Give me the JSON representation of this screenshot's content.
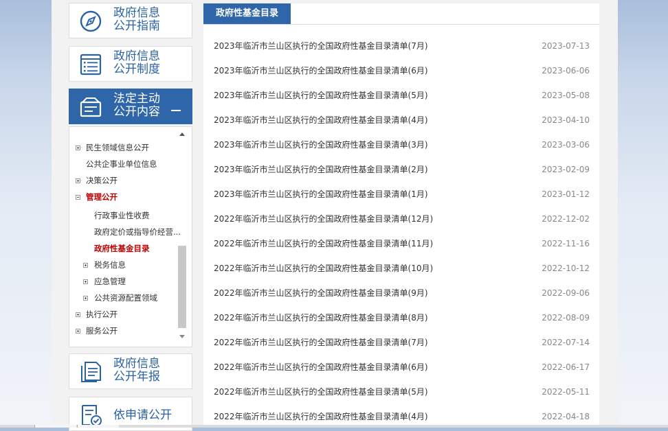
{
  "nav_cards": [
    {
      "line1": "政府信息",
      "line2": "公开指南",
      "icon": "compass-icon"
    },
    {
      "line1": "政府信息",
      "line2": "公开制度",
      "icon": "list-document-icon"
    },
    {
      "line1": "法定主动",
      "line2": "公开内容",
      "icon": "inbox-card-icon",
      "active": true
    },
    {
      "line1": "政府信息",
      "line2": "公开年报",
      "icon": "report-document-icon"
    },
    {
      "line1": "依申请公开",
      "icon": "application-check-icon"
    }
  ],
  "tree": {
    "items": [
      {
        "label": "民生领域信息公开",
        "expander": "plus"
      },
      {
        "label": "公共企事业单位信息"
      },
      {
        "label": "决策公开",
        "expander": "plus"
      },
      {
        "label": "管理公开",
        "expander": "minus",
        "current": true
      },
      {
        "label": "行政事业性收费"
      },
      {
        "label": "政府定价或指导价经营..."
      },
      {
        "label": "政府性基金目录",
        "current": true
      },
      {
        "label": "税务信息",
        "expander": "plus"
      },
      {
        "label": "应急管理",
        "expander": "plus"
      },
      {
        "label": "公共资源配置领域",
        "expander": "plus"
      },
      {
        "label": "执行公开",
        "expander": "plus"
      },
      {
        "label": "服务公开",
        "expander": "plus"
      }
    ]
  },
  "main": {
    "tab_title": "政府性基金目录",
    "list": [
      {
        "title": "2023年临沂市兰山区执行的全国政府性基金目录清单(7月)",
        "date": "2023-07-13"
      },
      {
        "title": "2023年临沂市兰山区执行的全国政府性基金目录清单(6月)",
        "date": "2023-06-06"
      },
      {
        "title": "2023年临沂市兰山区执行的全国政府性基金目录清单(5月)",
        "date": "2023-05-08"
      },
      {
        "title": "2023年临沂市兰山区执行的全国政府性基金目录清单(4月)",
        "date": "2023-04-10"
      },
      {
        "title": "2023年临沂市兰山区执行的全国政府性基金目录清单(3月)",
        "date": "2023-03-06"
      },
      {
        "title": "2023年临沂市兰山区执行的全国政府性基金目录清单(2月)",
        "date": "2023-02-09"
      },
      {
        "title": "2023年临沂市兰山区执行的全国政府性基金目录清单(1月)",
        "date": "2023-01-12"
      },
      {
        "title": "2022年临沂市兰山区执行的全国政府性基金目录清单(12月)",
        "date": "2022-12-02"
      },
      {
        "title": "2022年临沂市兰山区执行的全国政府性基金目录清单(11月)",
        "date": "2022-11-16"
      },
      {
        "title": "2022年临沂市兰山区执行的全国政府性基金目录清单(10月)",
        "date": "2022-10-12"
      },
      {
        "title": "2022年临沂市兰山区执行的全国政府性基金目录清单(9月)",
        "date": "2022-09-06"
      },
      {
        "title": "2022年临沂市兰山区执行的全国政府性基金目录清单(8月)",
        "date": "2022-08-09"
      },
      {
        "title": "2022年临沂市兰山区执行的全国政府性基金目录清单(7月)",
        "date": "2022-07-14"
      },
      {
        "title": "2022年临沂市兰山区执行的全国政府性基金目录清单(6月)",
        "date": "2022-06-17"
      },
      {
        "title": "2022年临沂市兰山区执行的全国政府性基金目录清单(5月)",
        "date": "2022-05-11"
      },
      {
        "title": "2022年临沂市兰山区执行的全国政府性基金目录清单(4月)",
        "date": "2022-04-18"
      }
    ]
  },
  "colors": {
    "accent": "#2e66a9",
    "current_red": "#c00000"
  }
}
